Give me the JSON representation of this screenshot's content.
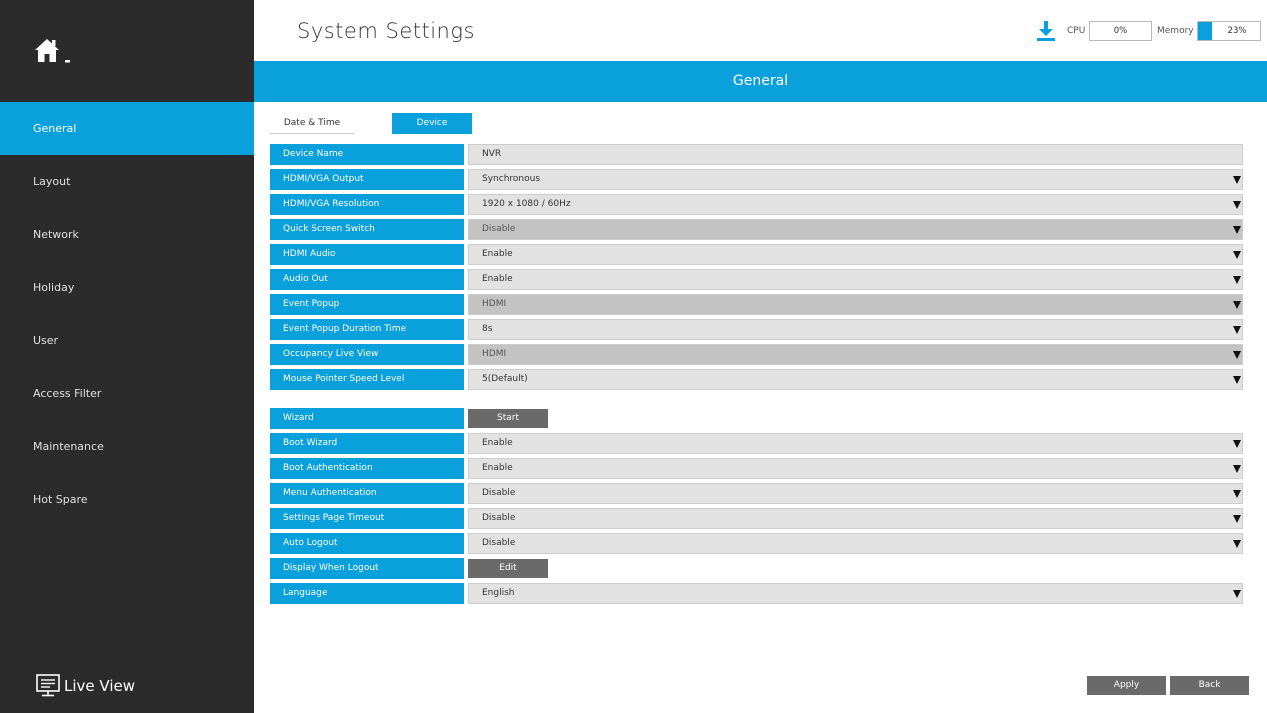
{
  "header": {
    "title": "System Settings",
    "download_icon": "download-icon",
    "cpu": {
      "label": "CPU",
      "value": "0%",
      "percent": 0
    },
    "memory": {
      "label": "Memory",
      "value": "23%",
      "percent": 23
    }
  },
  "sidebar": {
    "home_icon": "home-icon",
    "items": [
      {
        "label": "General",
        "active": true
      },
      {
        "label": "Layout",
        "active": false
      },
      {
        "label": "Network",
        "active": false
      },
      {
        "label": "Holiday",
        "active": false
      },
      {
        "label": "User",
        "active": false
      },
      {
        "label": "Access Filter",
        "active": false
      },
      {
        "label": "Maintenance",
        "active": false
      },
      {
        "label": "Hot Spare",
        "active": false
      }
    ],
    "live_view": {
      "label": "Live View",
      "icon": "monitor-icon"
    }
  },
  "banner": {
    "title": "General"
  },
  "tabs": [
    {
      "label": "Date & Time",
      "active": false
    },
    {
      "label": "Device",
      "active": true
    }
  ],
  "settings": {
    "group1": [
      {
        "label": "Device Name",
        "value": "NVR",
        "type": "text",
        "disabled": false
      },
      {
        "label": "HDMI/VGA Output",
        "value": "Synchronous",
        "type": "select",
        "disabled": false
      },
      {
        "label": "HDMI/VGA Resolution",
        "value": "1920 x 1080 / 60Hz",
        "type": "select",
        "disabled": false
      },
      {
        "label": "Quick Screen Switch",
        "value": "Disable",
        "type": "select",
        "disabled": true
      },
      {
        "label": "HDMI Audio",
        "value": "Enable",
        "type": "select",
        "disabled": false
      },
      {
        "label": "Audio Out",
        "value": "Enable",
        "type": "select",
        "disabled": false
      },
      {
        "label": "Event Popup",
        "value": "HDMI",
        "type": "select",
        "disabled": true
      },
      {
        "label": "Event Popup Duration Time",
        "value": "8s",
        "type": "select",
        "disabled": false
      },
      {
        "label": "Occupancy Live View",
        "value": "HDMI",
        "type": "select",
        "disabled": true
      },
      {
        "label": "Mouse Pointer Speed Level",
        "value": "5(Default)",
        "type": "select",
        "disabled": false
      }
    ],
    "group2": [
      {
        "label": "Wizard",
        "value": "Start",
        "type": "button",
        "disabled": false
      },
      {
        "label": "Boot Wizard",
        "value": "Enable",
        "type": "select",
        "disabled": false
      },
      {
        "label": "Boot Authentication",
        "value": "Enable",
        "type": "select",
        "disabled": false
      },
      {
        "label": "Menu Authentication",
        "value": "Disable",
        "type": "select",
        "disabled": false
      },
      {
        "label": "Settings Page Timeout",
        "value": "Disable",
        "type": "select",
        "disabled": false
      },
      {
        "label": "Auto Logout",
        "value": "Disable",
        "type": "select",
        "disabled": false
      },
      {
        "label": "Display When Logout",
        "value": "Edit",
        "type": "button",
        "disabled": false
      },
      {
        "label": "Language",
        "value": "English",
        "type": "select",
        "disabled": false
      }
    ]
  },
  "footer": {
    "apply_label": "Apply",
    "back_label": "Back"
  },
  "colors": {
    "accent": "#0aa0dc",
    "sidebar_bg": "#2b2b2b",
    "button_bg": "#6a6a6a",
    "field_bg": "#e2e2e2",
    "field_disabled_bg": "#c3c3c3"
  }
}
